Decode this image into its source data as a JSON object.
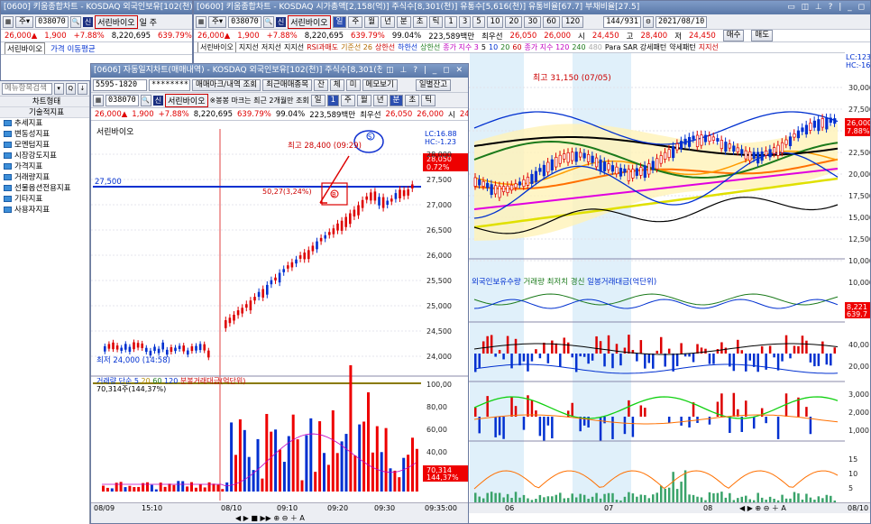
{
  "bg_window": {
    "title": "[0600] 키움종합차트 - KOSDAQ 외국인보유[102(천)]",
    "code": "038070",
    "stock": "서린바이오",
    "extra": "일 주",
    "price": "26,000▲",
    "change": "1,900",
    "rate": "+7.88%",
    "volume": "8,220,695",
    "pct": "639.79%"
  },
  "side_panel": {
    "tab": "서린바이오",
    "label": "가격 이동평균",
    "search": "메뉴항목검색",
    "header1": "차트형태",
    "header2": "기술적지표",
    "items": [
      "추세지표",
      "변동성지표",
      "모멘텀지표",
      "시장강도지표",
      "가격지표",
      "거래량지표",
      "선물옵션전용지표",
      "기타지표",
      "사용자지표"
    ]
  },
  "right_window": {
    "title": "[0600] 키움종합차트 - KOSDAQ 시가총액[2,158(억)] 주식수[8,301(천)] 유통수[5,616(천)] 유통비율[67.7] 부채비율[27.5]",
    "code": "038070",
    "stock": "서린바이오",
    "periods": [
      "일",
      "주",
      "월",
      "년",
      "분",
      "초",
      "틱"
    ],
    "nums": [
      "1",
      "3",
      "5",
      "10",
      "20",
      "30",
      "60",
      "120"
    ],
    "count": "144/931",
    "date": "2021/08/10",
    "price": "26,000▲",
    "change": "1,900",
    "rate": "+7.88%",
    "volume": "8,220,695",
    "pct": "639.79%",
    "ratio": "99.04%",
    "amount": "223,589백만",
    "best": "최우선",
    "bid": "26,050",
    "ask": "26,000",
    "hi_lbl": "시",
    "open": "24,450",
    "hi2_lbl": "고",
    "high": "28,400",
    "lo_lbl": "저",
    "low": "24,450",
    "buy": "매수",
    "sell": "매도",
    "legend": [
      "서린바이오",
      "지지선",
      "저지선",
      "지지선",
      "RSI과매도",
      "기준선 26",
      "상한선",
      "하한선",
      "상한선",
      "종가 지수 3",
      "5",
      "10",
      "20",
      "60",
      "종가 지수 120",
      "240",
      "480",
      "Para SAR 강세패턴",
      "약세패턴",
      "지지선"
    ],
    "legend2": [
      "외국인보유수량",
      "거래량 최저치 경신",
      "일봉거래대금(억단위)"
    ],
    "max_label": "최고 31,150 (07/05)",
    "price_axis": [
      "30,000",
      "27,500",
      "25,000",
      "22,500",
      "20,000",
      "17,500",
      "15,000",
      "12,500",
      "10,000"
    ],
    "cur_price": "26,000",
    "cur_rate": "7.88%",
    "foreign_val": "8,221",
    "foreign_sub": "639.7",
    "lc": "LC:123",
    "hc": "HC:-16",
    "mid_axis": [
      "10,000"
    ],
    "vol_axis": [
      "40,00",
      "20,00"
    ],
    "sub_axis": [
      "3,000",
      "2,000",
      "1,000"
    ],
    "amt_axis": [
      "15",
      "10",
      "5"
    ],
    "dates": [
      "06",
      "07",
      "08"
    ],
    "end_date": "08/10"
  },
  "mid_window": {
    "title": "[0606] 자동일지차트(매매내역) - KOSDAQ 외국인보유[102(천)] 주식수[8,301(천)] 액면[500] 자본금[42",
    "account": "5595-1820",
    "password": "********",
    "btn_trade": "매매마크/내역 조회",
    "btn_recent": "최근매매종목",
    "btn_jan": "잔",
    "btn_che": "체",
    "btn_mi": "미",
    "btn_memo": "메모보기",
    "btn_daily": "일별잔고",
    "code": "038070",
    "stock": "서린바이오",
    "hint": "※봉봉 마크는 최근 2개월만 조회",
    "period": "일",
    "p1": "1",
    "pw": "주",
    "pm": "월",
    "py": "년",
    "pb": "분",
    "pc": "초",
    "pt": "틱",
    "price": "26,000▲",
    "change": "1,900",
    "rate": "+7.88%",
    "volume": "8,220,695",
    "pct": "639.79%",
    "ratio": "99.04%",
    "amount": "223,589백만",
    "best": "최우선",
    "bid": "26,050",
    "ask": "26,000",
    "hi_lbl": "시",
    "open": "24",
    "chart_title": "서린바이오",
    "hi_label": "최고 28,400 (09:29)",
    "lo_label": "최저 24,000 (14:58)",
    "mid_note": "50,27(3,24%)",
    "line_label": "27,500",
    "lc": "LC:16.88",
    "hc": "HC:-1.23",
    "cur_price": "28,050",
    "cur_rate": "0.72%",
    "price_axis": [
      "28,000",
      "27,500",
      "27,000",
      "26,500",
      "26,000",
      "25,500",
      "25,000",
      "24,500",
      "24,000"
    ],
    "vol_legend": [
      "거래량",
      "단순 5",
      "20",
      "60",
      "120",
      "분봉거래대금(억단위)"
    ],
    "vol_note": "70,314주(144,37%)",
    "vol_axis": [
      "100,00",
      "80,00",
      "60,00",
      "40,00",
      "20,00"
    ],
    "vol_cur": "70,314",
    "vol_cur2": "144,37%",
    "time_axis": [
      "08/09",
      "15:10",
      "08/10",
      "09:10",
      "09:20",
      "09:30",
      "09:35:00"
    ]
  }
}
